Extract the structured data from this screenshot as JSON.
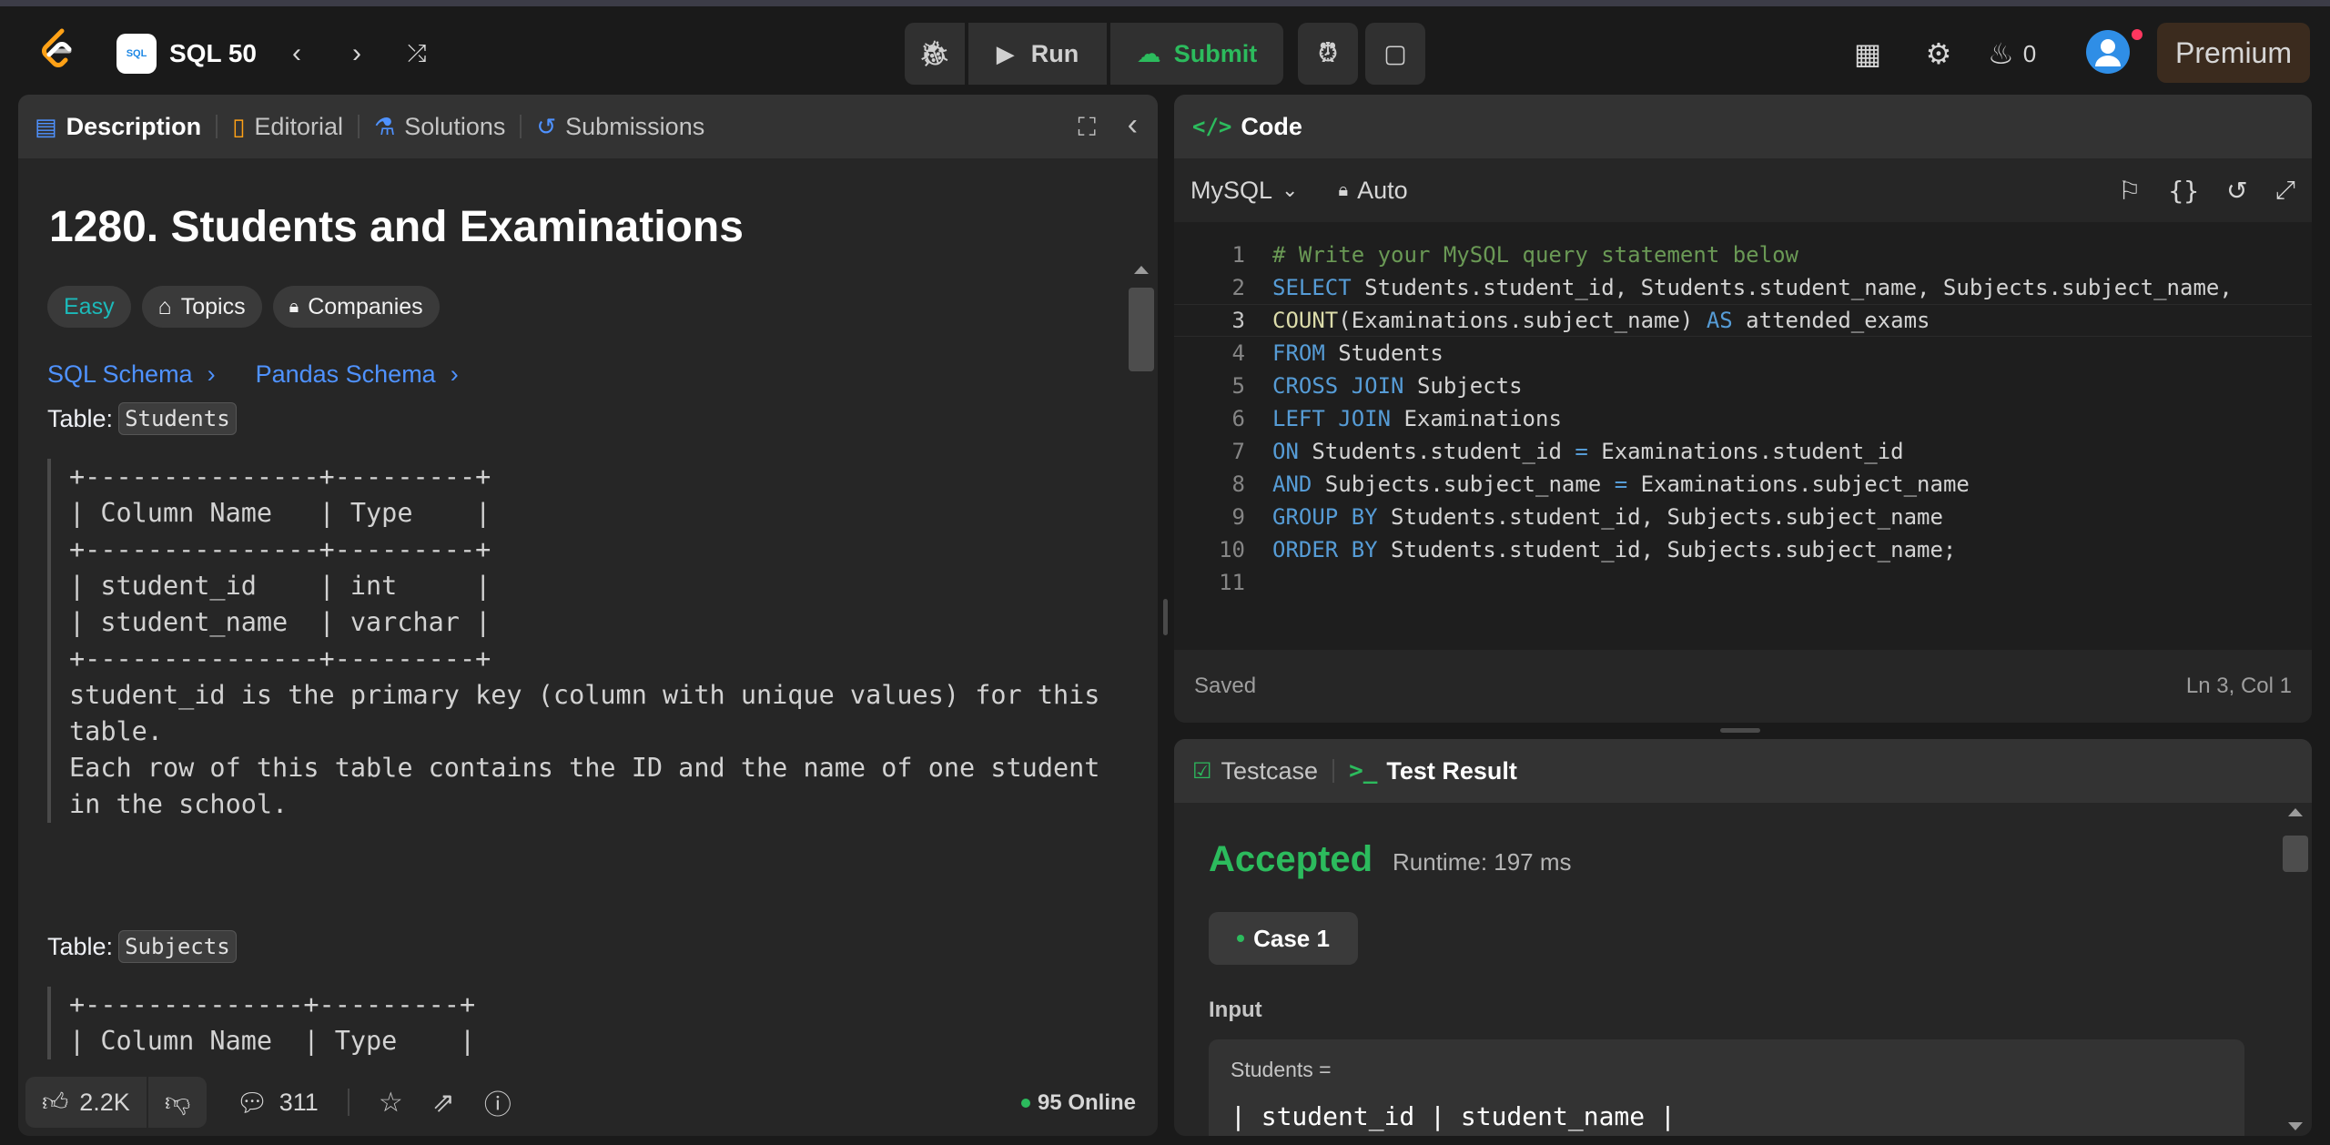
{
  "nav": {
    "title": "SQL 50",
    "run_label": "Run",
    "submit_label": "Submit",
    "streak_count": "0",
    "premium_label": "Premium"
  },
  "description": {
    "tabs": [
      {
        "label": "Description"
      },
      {
        "label": "Editorial"
      },
      {
        "label": "Solutions"
      },
      {
        "label": "Submissions"
      }
    ],
    "title": "1280. Students and Examinations",
    "chips": {
      "difficulty": "Easy",
      "topics": "Topics",
      "companies": "Companies"
    },
    "schemas": {
      "sql": "SQL Schema",
      "pandas": "Pandas Schema"
    },
    "table1": {
      "label": "Table:",
      "name": "Students",
      "block": "+---------------+---------+\n| Column Name   | Type    |\n+---------------+---------+\n| student_id    | int     |\n| student_name  | varchar |\n+---------------+---------+\nstudent_id is the primary key (column with unique values) for this\ntable.\nEach row of this table contains the ID and the name of one student\nin the school."
    },
    "table2": {
      "label": "Table:",
      "name": "Subjects",
      "block": "+--------------+---------+\n| Column Name  | Type    |"
    },
    "footer": {
      "likes": "2.2K",
      "comments": "311",
      "online": "95 Online"
    }
  },
  "code": {
    "tab_label": "Code",
    "language": "MySQL",
    "auto_label": "Auto",
    "current_line": 3,
    "lines": [
      [
        {
          "t": "cm",
          "v": "# Write your MySQL query statement below"
        }
      ],
      [
        {
          "t": "kw",
          "v": "SELECT"
        },
        {
          "t": "",
          "v": " Students.student_id, Students.student_name, Subjects.subject_name,"
        }
      ],
      [
        {
          "t": "fn",
          "v": "COUNT"
        },
        {
          "t": "",
          "v": "(Examinations.subject_name) "
        },
        {
          "t": "kw",
          "v": "AS"
        },
        {
          "t": "",
          "v": " attended_exams"
        }
      ],
      [
        {
          "t": "kw",
          "v": "FROM"
        },
        {
          "t": "",
          "v": " Students"
        }
      ],
      [
        {
          "t": "kw",
          "v": "CROSS JOIN"
        },
        {
          "t": "",
          "v": " Subjects"
        }
      ],
      [
        {
          "t": "kw",
          "v": "LEFT JOIN"
        },
        {
          "t": "",
          "v": " Examinations"
        }
      ],
      [
        {
          "t": "kw",
          "v": "ON"
        },
        {
          "t": "",
          "v": " Students.student_id "
        },
        {
          "t": "kw",
          "v": "="
        },
        {
          "t": "",
          "v": " Examinations.student_id"
        }
      ],
      [
        {
          "t": "kw",
          "v": "AND"
        },
        {
          "t": "",
          "v": " Subjects.subject_name "
        },
        {
          "t": "kw",
          "v": "="
        },
        {
          "t": "",
          "v": " Examinations.subject_name"
        }
      ],
      [
        {
          "t": "kw",
          "v": "GROUP BY"
        },
        {
          "t": "",
          "v": " Students.student_id, Subjects.subject_name"
        }
      ],
      [
        {
          "t": "kw",
          "v": "ORDER BY"
        },
        {
          "t": "",
          "v": " Students.student_id, Subjects.subject_name;"
        }
      ],
      []
    ],
    "saved_label": "Saved",
    "cursor_pos": "Ln 3, Col 1"
  },
  "result": {
    "tabs": [
      {
        "label": "Testcase"
      },
      {
        "label": "Test Result"
      }
    ],
    "status": "Accepted",
    "runtime": "Runtime: 197 ms",
    "case_label": "Case 1",
    "input_label": "Input",
    "input_var": "Students =",
    "input_value": "| student_id | student_name |"
  },
  "colors": {
    "accent": "#ffa116",
    "success": "#2cbb5d",
    "link": "#4f92ff",
    "easy": "#1cbaba"
  }
}
